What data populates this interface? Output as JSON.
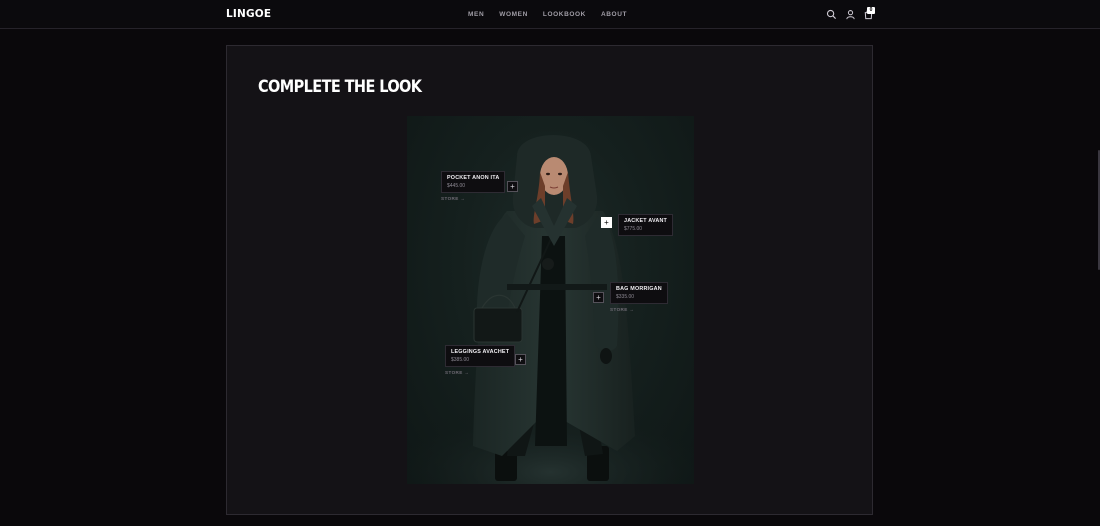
{
  "header": {
    "logo": "LINGOE",
    "nav": [
      "MEN",
      "WOMEN",
      "LOOKBOOK",
      "ABOUT"
    ],
    "cart_count": "0",
    "icons": [
      "search-icon",
      "user-icon",
      "cart-icon"
    ]
  },
  "section": {
    "title": "COMPLETE THE LOOK"
  },
  "hotspots": [
    {
      "name": "POCKET ANON ITA",
      "price": "$445.00",
      "link": "STORE →"
    },
    {
      "name": "JACKET AVANT",
      "price": "$775.00"
    },
    {
      "name": "BAG MORRIGAN",
      "price": "$335.00",
      "link": "STORE →"
    },
    {
      "name": "LEGGINGS AVACHET",
      "price": "$385.00",
      "link": "STORE →"
    }
  ],
  "plus_glyph": "+",
  "colors": {
    "background": "#0a080b",
    "card": "#141216",
    "accent": "#ffffff"
  }
}
